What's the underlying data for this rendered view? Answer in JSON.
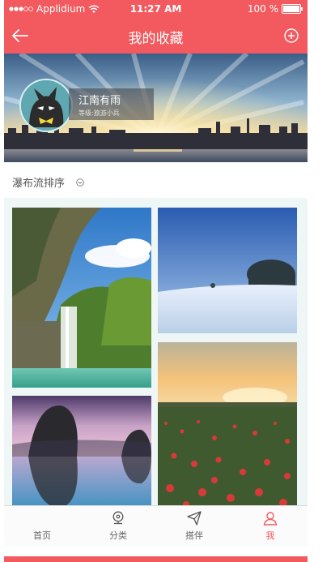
{
  "status_bar": {
    "carrier": "Applidium",
    "time": "11:27 AM",
    "battery": "100 %"
  },
  "nav": {
    "title": "我的收藏",
    "back_icon": "arrow-left-icon",
    "add_icon": "plus-circle-icon"
  },
  "profile": {
    "name": "江南有雨",
    "level": "等级:旅游小兵"
  },
  "sort": {
    "label": "瀑布流排序",
    "icon": "chevron-down-circle-icon"
  },
  "gallery": {
    "items": [
      {
        "name": "waterfall-photo"
      },
      {
        "name": "snowfield-photo"
      },
      {
        "name": "lake-rock-photo"
      },
      {
        "name": "flower-field-photo"
      }
    ]
  },
  "tabbar": {
    "items": [
      {
        "label": "首页",
        "icon": "home-icon"
      },
      {
        "label": "分类",
        "icon": "location-pin-icon"
      },
      {
        "label": "搭伴",
        "icon": "paper-plane-icon"
      },
      {
        "label": "我",
        "icon": "user-icon"
      }
    ],
    "active_index": 3
  },
  "colors": {
    "accent": "#f25a5f",
    "grid_bg": "#eef6f6"
  }
}
